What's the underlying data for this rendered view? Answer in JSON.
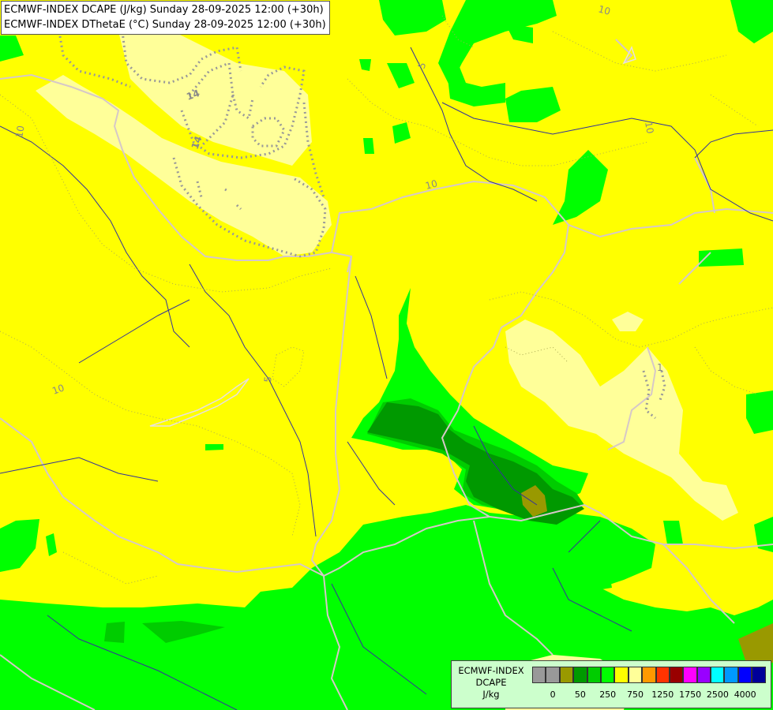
{
  "header": {
    "line1": "ECMWF-INDEX DCAPE (J/kg) Sunday 28-09-2025 12:00 (+30h)",
    "line2": "ECMWF-INDEX DThetaE (°C) Sunday 28-09-2025 12:00 (+30h)"
  },
  "legend": {
    "line1": "ECMWF-INDEX",
    "line2": "DCAPE",
    "line3": "J/kg",
    "colors": [
      "#999999",
      "#999999",
      "#999900",
      "#009900",
      "#00cc00",
      "#00ff00",
      "#ffff00",
      "#ffff99",
      "#ff9900",
      "#ff3300",
      "#990000",
      "#ff00ff",
      "#9900ff",
      "#00ffff",
      "#0099ff",
      "#0000ff",
      "#000099"
    ],
    "tick_labels": [
      "0",
      "50",
      "250",
      "750",
      "1250",
      "1750",
      "2500",
      "4000"
    ]
  },
  "contour_labels": [
    "10",
    "5",
    "10",
    "10",
    "14",
    "14",
    "10",
    "5",
    "10",
    "1"
  ],
  "colors": {
    "yellow": "#ffff00",
    "light_yellow": "#ffff99",
    "green": "#00ff00",
    "mid_green": "#00cc00",
    "dark_green": "#009900",
    "olive": "#999900",
    "border": "#d6c8c8",
    "river": "#333399"
  }
}
